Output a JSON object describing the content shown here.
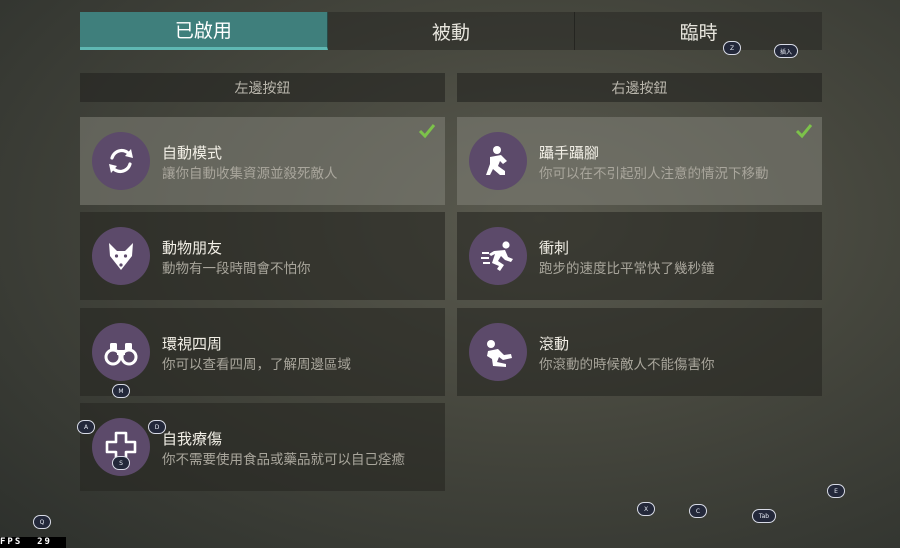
{
  "tabs": [
    {
      "label": "已啟用",
      "active": true
    },
    {
      "label": "被動",
      "active": false
    },
    {
      "label": "臨時",
      "active": false
    }
  ],
  "columns": {
    "left_header": "左邊按鈕",
    "right_header": "右邊按鈕"
  },
  "left_skills": [
    {
      "title": "自動模式",
      "desc": "讓你自動收集資源並殺死敵人",
      "icon": "cycle-icon",
      "selected": true
    },
    {
      "title": "動物朋友",
      "desc": "動物有一段時間會不怕你",
      "icon": "fox-icon",
      "selected": false
    },
    {
      "title": "環視四周",
      "desc": "你可以查看四周，了解周邊區域",
      "icon": "binoculars-icon",
      "selected": false
    },
    {
      "title": "自我療傷",
      "desc": "你不需要使用食品或藥品就可以自己痊癒",
      "icon": "medical-cross-icon",
      "selected": false
    }
  ],
  "right_skills": [
    {
      "title": "躡手躡腳",
      "desc": "你可以在不引起別人注意的情況下移動",
      "icon": "crouch-icon",
      "selected": true
    },
    {
      "title": "衝刺",
      "desc": "跑步的速度比平常快了幾秒鐘",
      "icon": "sprint-icon",
      "selected": false
    },
    {
      "title": "滾動",
      "desc": "你滾動的時候敵人不能傷害你",
      "icon": "roll-icon",
      "selected": false
    }
  ],
  "key_hints": {
    "z": "Z",
    "insert": "插入",
    "m": "M",
    "a": "A",
    "d": "D",
    "s": "S",
    "q": "Q",
    "x": "X",
    "c": "C",
    "tab": "Tab",
    "e": "E"
  },
  "fps": {
    "label": "FPS",
    "value": "29"
  },
  "colors": {
    "accent": "#3f7f7c",
    "icon_bg": "#5c4a6a",
    "check": "#7cc24a"
  }
}
